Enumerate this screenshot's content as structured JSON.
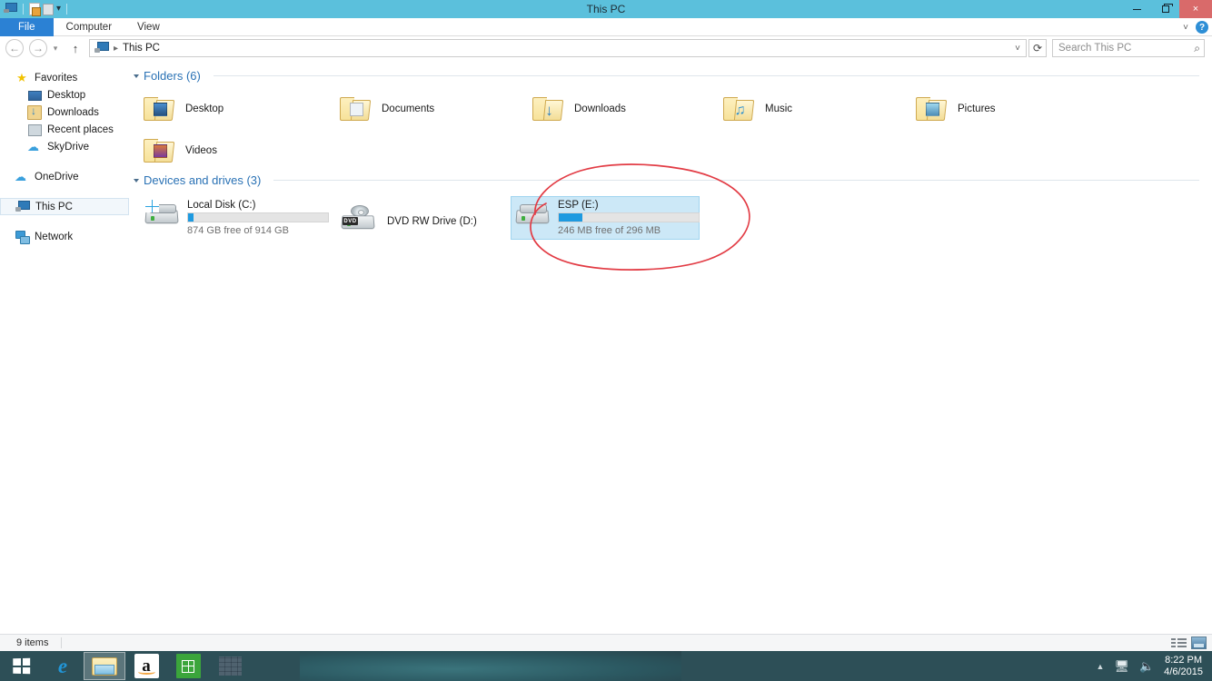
{
  "window": {
    "title": "This PC",
    "quick_access": [
      "pc-icon",
      "properties-icon",
      "new-folder-icon",
      "customize-caret"
    ],
    "controls": {
      "minimize": "minimize",
      "restore": "restore",
      "close": "×"
    }
  },
  "ribbon": {
    "tabs": [
      {
        "label": "File",
        "active": true
      },
      {
        "label": "Computer",
        "active": false
      },
      {
        "label": "View",
        "active": false
      }
    ],
    "expand_label": "˅",
    "help_label": "?"
  },
  "address": {
    "back": "←",
    "forward": "→",
    "history": "˅",
    "up": "↑",
    "crumb_icon": "pc-icon",
    "crumb": "This PC",
    "crumb_sep": "▸",
    "dropdown": "˅",
    "refresh": "⟳"
  },
  "search": {
    "placeholder": "Search This PC",
    "value": "",
    "icon": "search-icon"
  },
  "sidebar": {
    "items": [
      {
        "label": "Favorites",
        "icon": "star-icon",
        "indent": false,
        "selected": false
      },
      {
        "label": "Desktop",
        "icon": "desktop-icon",
        "indent": true,
        "selected": false
      },
      {
        "label": "Downloads",
        "icon": "downloads-icon",
        "indent": true,
        "selected": false
      },
      {
        "label": "Recent places",
        "icon": "recent-places-icon",
        "indent": true,
        "selected": false
      },
      {
        "label": "SkyDrive",
        "icon": "cloud-icon",
        "indent": true,
        "selected": false
      },
      {
        "label": "OneDrive",
        "icon": "cloud-icon",
        "indent": false,
        "selected": false
      },
      {
        "label": "This PC",
        "icon": "pc-icon",
        "indent": false,
        "selected": true
      },
      {
        "label": "Network",
        "icon": "network-icon",
        "indent": false,
        "selected": false
      }
    ]
  },
  "main": {
    "groups": [
      {
        "title": "Folders (6)"
      },
      {
        "title": "Devices and drives (3)"
      }
    ],
    "folders": [
      {
        "label": "Desktop",
        "icon": "folder-desktop-icon"
      },
      {
        "label": "Documents",
        "icon": "folder-documents-icon"
      },
      {
        "label": "Downloads",
        "icon": "folder-downloads-icon"
      },
      {
        "label": "Music",
        "icon": "folder-music-icon"
      },
      {
        "label": "Pictures",
        "icon": "folder-pictures-icon"
      },
      {
        "label": "Videos",
        "icon": "folder-videos-icon"
      }
    ],
    "drives": [
      {
        "name": "Local Disk (C:)",
        "icon": "hard-drive-windows-icon",
        "free_text": "874 GB free of 914 GB",
        "used_percent": 4,
        "selected": false,
        "has_bar": true
      },
      {
        "name": "DVD RW Drive (D:)",
        "icon": "dvd-drive-icon",
        "free_text": "",
        "used_percent": 0,
        "selected": false,
        "has_bar": false
      },
      {
        "name": "ESP (E:)",
        "icon": "hard-drive-icon",
        "free_text": "246 MB free of 296 MB",
        "used_percent": 17,
        "selected": true,
        "has_bar": true
      }
    ],
    "annotation": {
      "shape": "hand-drawn-ellipse",
      "color": "#e23b44",
      "target": "ESP (E:)"
    }
  },
  "statusbar": {
    "items_count": "9 items",
    "views": [
      {
        "name": "details-view-button",
        "label": "Details view"
      },
      {
        "name": "large-icons-view-button",
        "label": "Large icons view"
      }
    ]
  },
  "taskbar": {
    "start_label": "Start",
    "items": [
      {
        "name": "internet-explorer",
        "label": "Internet Explorer",
        "active": false
      },
      {
        "name": "file-explorer",
        "label": "File Explorer",
        "active": true
      },
      {
        "name": "amazon",
        "label": "Amazon",
        "active": false
      },
      {
        "name": "windows-store",
        "label": "Store",
        "active": false
      },
      {
        "name": "bricks-app",
        "label": "App",
        "active": false
      }
    ],
    "tray": {
      "caret": "▲",
      "network": "network-icon",
      "volume": "🔊"
    },
    "clock": {
      "time": "8:22 PM",
      "date": "4/6/2015"
    }
  },
  "colors": {
    "titlebar": "#5bc0dc",
    "file_tab": "#2b81d4",
    "selection": "#cce8f7",
    "bar_fill": "#1e9ae0",
    "annotation": "#e23b44",
    "taskbar": "#2d4f57"
  }
}
